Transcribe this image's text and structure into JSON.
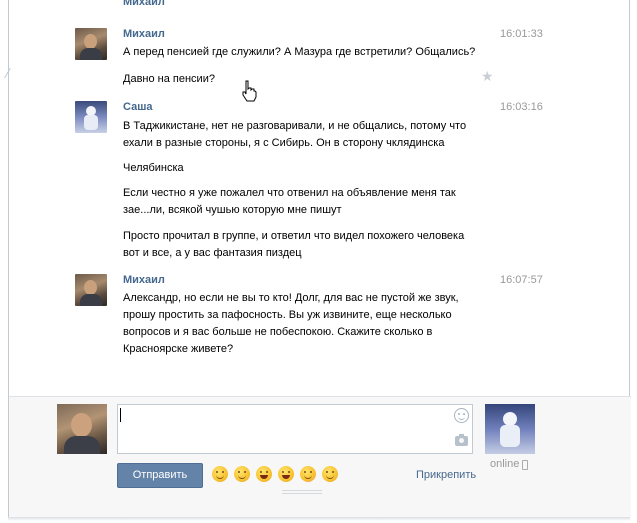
{
  "partial_top_text": "Михаил",
  "messages": [
    {
      "author": "Михаил",
      "time": "16:01:33",
      "lines": [
        "А перед пенсией где служили? А Мазура где встретили? Общались?"
      ],
      "lines2": [
        "Давно на пенсии?"
      ]
    },
    {
      "author": "Саша",
      "time": "16:03:16",
      "p1": [
        "В Таджикистане, нет не разговаривали, и не общались, потому что",
        "ехали в разные стороны, я с Сибирь. Он в сторону чклядинска"
      ],
      "p2": [
        "Челябинска"
      ],
      "p3": [
        "Если честно я уже пожалел что отвенил на объявление меня так",
        "зае...ли, всякой чушью которую мне пишут"
      ],
      "p4": [
        "Просто прочитал в группе, и ответил что видел похожего человека",
        "вот и все, а у вас фантазия пиздец"
      ]
    },
    {
      "author": "Михаил",
      "time": "16:07:57",
      "p1": [
        "Александр, но если не вы то кто! Долг, для вас не пустой же звук,",
        "прошу простить за пафосность. Вы уж извините, еще несколько",
        "вопросов и я вас больше не побеспокою. Скажите сколько в",
        "Красноярске живете?"
      ]
    }
  ],
  "compose": {
    "input_value": "",
    "send_label": "Отправить",
    "attach_label": "Прикрепить",
    "peer_status": "online"
  },
  "icons": {
    "star": "star-icon",
    "smile": "smile-icon",
    "camera": "camera-icon",
    "cursor": "hand-cursor-icon",
    "phone": "mobile-phone-icon"
  },
  "colors": {
    "author": "#45688e",
    "button": "#6383a8",
    "time": "#999999"
  }
}
